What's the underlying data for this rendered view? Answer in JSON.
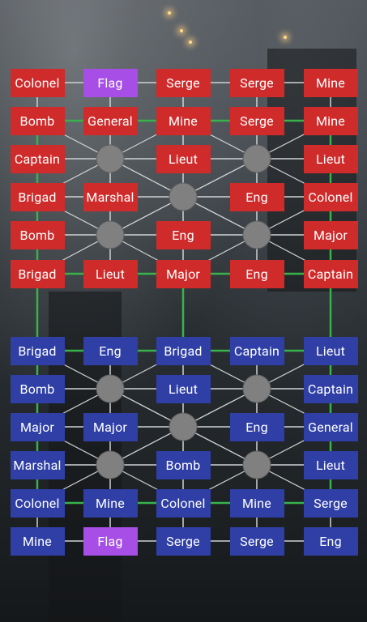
{
  "colors": {
    "red_team": "#cf2b2b",
    "blue_team": "#2f3fa6",
    "flag": "#a64ee6",
    "railroad": "#38b24a",
    "road": "#cfd2d4",
    "camp": "#808080"
  },
  "top_army": {
    "team": "red",
    "rows": [
      [
        "Colonel",
        "Flag",
        "Serge",
        "Serge",
        "Mine"
      ],
      [
        "Bomb",
        "General",
        "Mine",
        "Serge",
        "Mine"
      ],
      [
        "Captain",
        "",
        "Lieut",
        "",
        "Lieut"
      ],
      [
        "Brigad",
        "Marshal",
        "",
        "Eng",
        "Colonel"
      ],
      [
        "Bomb",
        "",
        "Eng",
        "",
        "Major"
      ],
      [
        "Brigad",
        "Lieut",
        "Major",
        "Eng",
        "Captain"
      ]
    ]
  },
  "bottom_army": {
    "team": "blue",
    "rows": [
      [
        "Brigad",
        "Eng",
        "Brigad",
        "Captain",
        "Lieut"
      ],
      [
        "Bomb",
        "",
        "Lieut",
        "",
        "Captain"
      ],
      [
        "Major",
        "Major",
        "",
        "Eng",
        "General"
      ],
      [
        "Marshal",
        "",
        "Bomb",
        "",
        "Lieut"
      ],
      [
        "Colonel",
        "Mine",
        "Colonel",
        "Mine",
        "Serge"
      ],
      [
        "Mine",
        "Flag",
        "Serge",
        "Serge",
        "Eng"
      ]
    ]
  }
}
